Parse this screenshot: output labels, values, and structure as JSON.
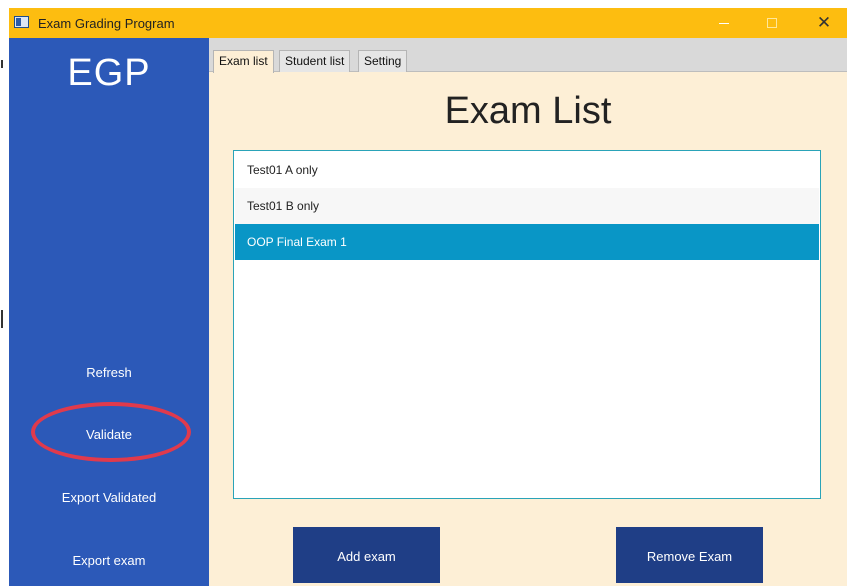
{
  "window": {
    "title": "Exam Grading Program",
    "controls": {
      "minimize": "—",
      "maximize": "",
      "close": "✕"
    }
  },
  "sidebar": {
    "brand": "EGP",
    "items": [
      {
        "label": "Refresh"
      },
      {
        "label": "Validate"
      },
      {
        "label": "Export Validated"
      },
      {
        "label": "Export exam"
      }
    ]
  },
  "tabs": [
    {
      "label": "Exam list",
      "active": true
    },
    {
      "label": "Student list",
      "active": false
    },
    {
      "label": "Setting",
      "active": false
    }
  ],
  "main": {
    "title": "Exam List",
    "exams": [
      {
        "label": "Test01 A only",
        "selected": false
      },
      {
        "label": "Test01 B only",
        "selected": false
      },
      {
        "label": "OOP Final Exam 1",
        "selected": true
      }
    ],
    "add_button": "Add exam",
    "remove_button": "Remove Exam"
  },
  "colors": {
    "titlebar": "#fdbd10",
    "sidebar": "#2c59b8",
    "content_bg": "#fdefd6",
    "selection": "#0996c6",
    "button": "#1f3e86",
    "annotation": "#e03a4c"
  }
}
